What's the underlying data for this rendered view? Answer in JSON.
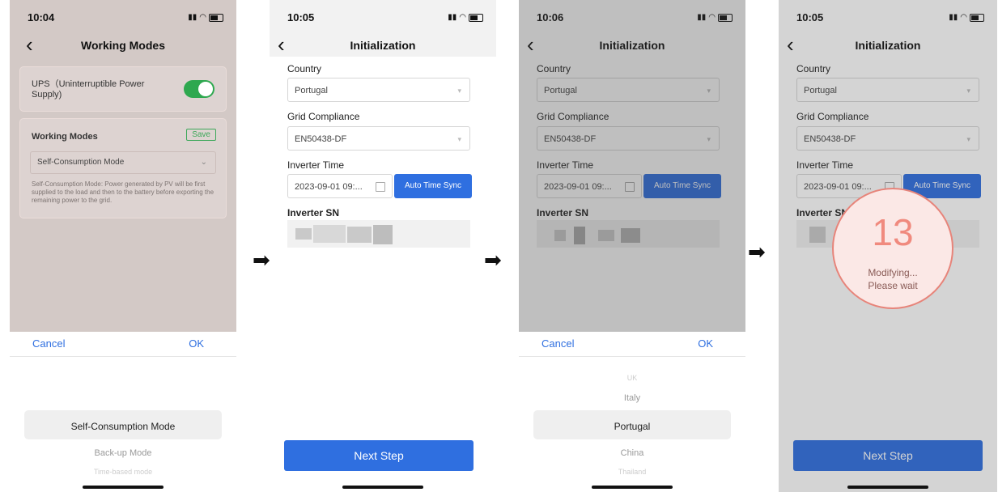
{
  "colors": {
    "accent": "#2f6fe0",
    "toggle_on": "#2ea84f",
    "modal_ring": "#e7847a",
    "modal_number": "#f08a7e"
  },
  "screens": [
    {
      "time": "10:04",
      "title": "Working Modes",
      "ups_label": "UPS（Uninterruptible Power Supply)",
      "ups_enabled": true,
      "section_title": "Working Modes",
      "save_label": "Save",
      "mode_value": "Self-Consumption Mode",
      "description": "Self-Consumption Mode: Power generated by PV will be first supplied to the load and then to the battery before exporting the remaining power to the grid.",
      "cancel": "Cancel",
      "ok": "OK",
      "picker": [
        "Self-Consumption Mode",
        "Back-up Mode",
        "Time-based mode"
      ]
    },
    {
      "time": "10:05",
      "title": "Initialization",
      "country_label": "Country",
      "country_value": "Portugal",
      "grid_label": "Grid Compliance",
      "grid_value": "EN50438-DF",
      "time_label": "Inverter Time",
      "time_value": "2023-09-01 09:...",
      "sync_label": "Auto Time Sync",
      "sn_label": "Inverter SN",
      "next_label": "Next Step"
    },
    {
      "time": "10:06",
      "title": "Initialization",
      "country_label": "Country",
      "country_value": "Portugal",
      "grid_label": "Grid Compliance",
      "grid_value": "EN50438-DF",
      "time_label": "Inverter Time",
      "time_value": "2023-09-01 09:...",
      "sync_label": "Auto Time Sync",
      "sn_label": "Inverter SN",
      "cancel": "Cancel",
      "ok": "OK",
      "picker": [
        "UK",
        "Italy",
        "Portugal",
        "China",
        "Thailand"
      ]
    },
    {
      "time": "10:05",
      "title": "Initialization",
      "country_label": "Country",
      "country_value": "Portugal",
      "grid_label": "Grid Compliance",
      "grid_value": "EN50438-DF",
      "time_label": "Inverter Time",
      "time_value": "2023-09-01 09:...",
      "sync_label": "Auto Time Sync",
      "sn_label": "Inverter SN",
      "next_label": "Next Step",
      "countdown": "13",
      "modal_line1": "Modifying...",
      "modal_line2": "Please wait"
    }
  ]
}
